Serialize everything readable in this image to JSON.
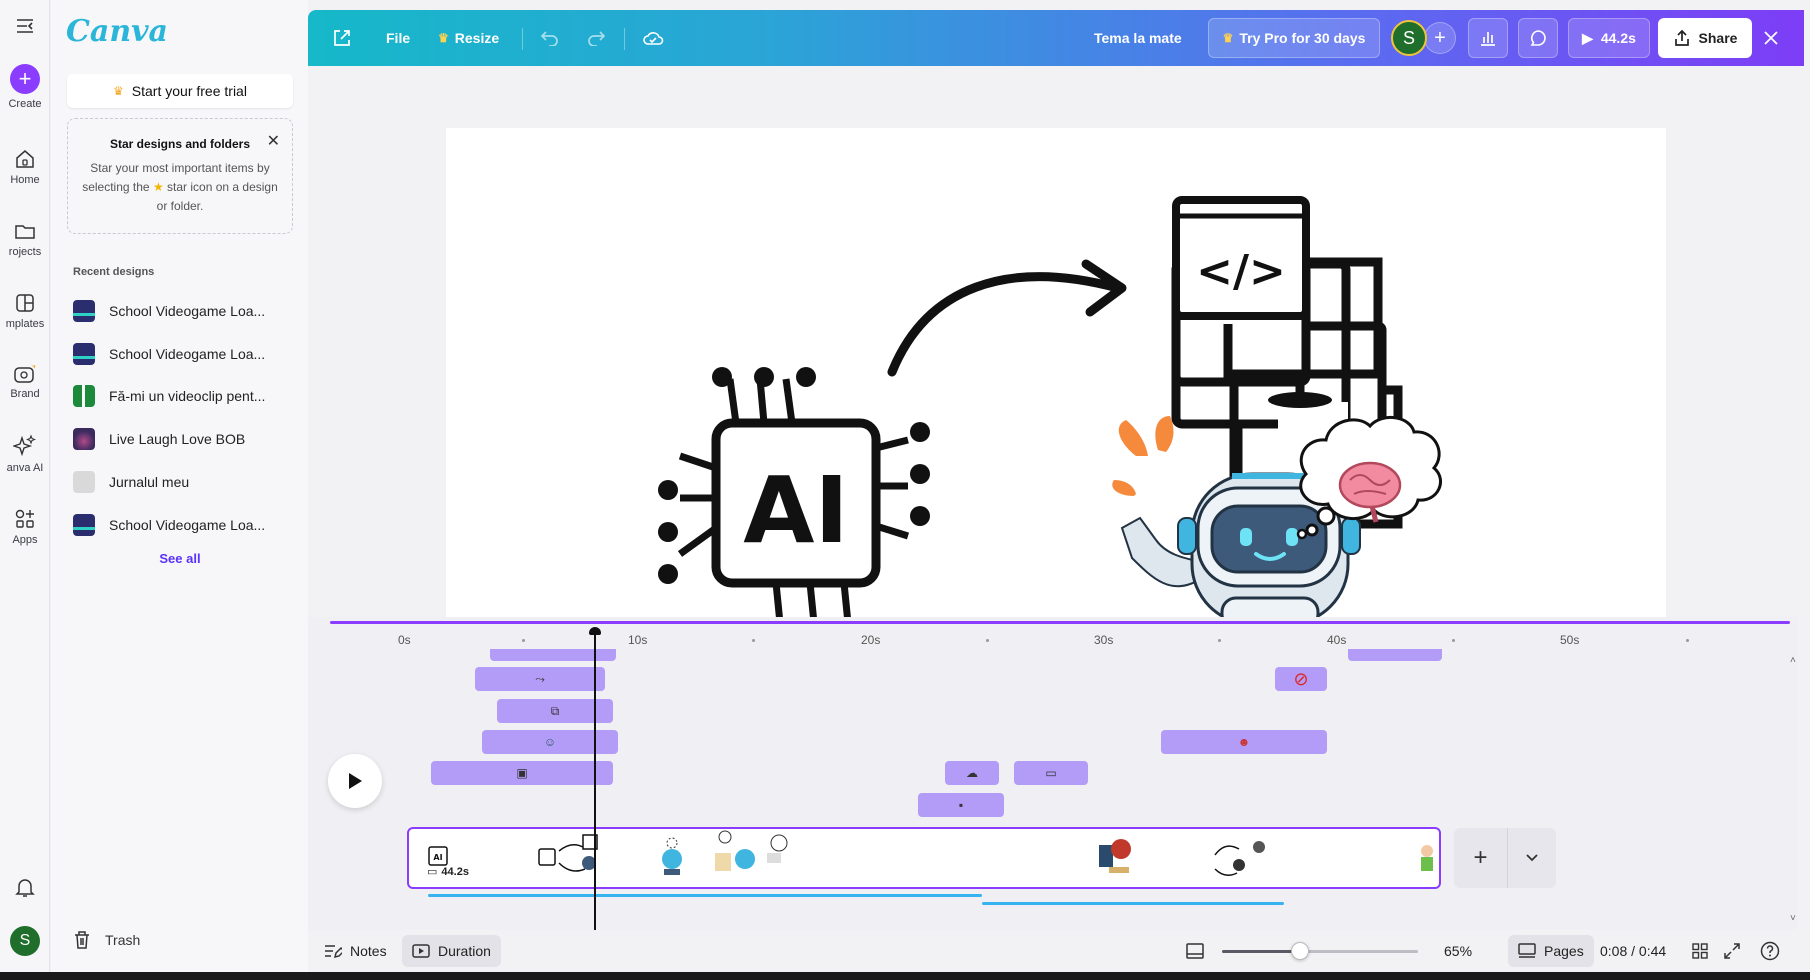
{
  "app": {
    "logo": "Canva"
  },
  "rail": {
    "items": [
      {
        "label": "Create",
        "icon": "plus-icon"
      },
      {
        "label": "Home",
        "icon": "home-icon"
      },
      {
        "label": "rojects",
        "icon": "folder-icon"
      },
      {
        "label": "mplates",
        "icon": "templates-icon"
      },
      {
        "label": "Brand",
        "icon": "brand-icon"
      },
      {
        "label": "anva AI",
        "icon": "sparkle-icon"
      },
      {
        "label": "Apps",
        "icon": "apps-icon"
      }
    ],
    "avatar_letter": "S"
  },
  "panel": {
    "trial_label": "Start your free trial",
    "tip": {
      "title": "Star designs and folders",
      "line1": "Star your most important items by",
      "line2a": "selecting the",
      "line2b": "star icon on a design",
      "line3": "or folder."
    },
    "recent_title": "Recent designs",
    "recent": [
      {
        "name": "School Videogame Loa...",
        "thumb_color": "#2a2d6e"
      },
      {
        "name": "School Videogame Loa...",
        "thumb_color": "#2a2d6e"
      },
      {
        "name": "Fă-mi un videoclip pent...",
        "thumb_color": "#1b8a3a"
      },
      {
        "name": "Live Laugh Love BOB",
        "thumb_color": "#3b2a5e"
      },
      {
        "name": "Jurnalul meu",
        "thumb_color": "#d9d9d9"
      },
      {
        "name": "School Videogame Loa...",
        "thumb_color": "#2a2d6e"
      }
    ],
    "see_all": "See all",
    "trash": "Trash"
  },
  "topbar": {
    "file": "File",
    "resize": "Resize",
    "design_title": "Tema la mate",
    "try_pro": "Try Pro for 30 days",
    "avatar_letter": "S",
    "play_duration": "44.2s",
    "share": "Share"
  },
  "canvas": {
    "ai_text": "AI",
    "code_text": "</>"
  },
  "timeline": {
    "ticks": [
      "0s",
      "10s",
      "20s",
      "30s",
      "40s",
      "50s"
    ],
    "track_duration": "44.2s",
    "track_thumb_label": "AI"
  },
  "bottombar": {
    "notes": "Notes",
    "duration": "Duration",
    "zoom": "65%",
    "zoom_level": 0.4,
    "pages": "Pages",
    "time": "0:08 / 0:44"
  },
  "colors": {
    "accent": "#8b3dff",
    "clip": "#b39cf7",
    "audio": "#36b3f0"
  }
}
